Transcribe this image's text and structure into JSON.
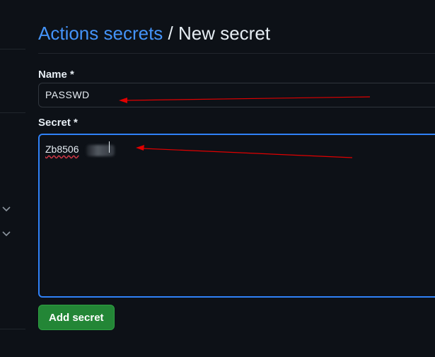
{
  "header": {
    "breadcrumb_link": "Actions secrets",
    "separator": " / ",
    "current": "New secret"
  },
  "form": {
    "name_label": "Name *",
    "name_value": "PASSWD",
    "secret_label": "Secret *",
    "secret_value_visible": "Zb8506"
  },
  "actions": {
    "add_label": "Add secret"
  },
  "colors": {
    "link": "#4493f8",
    "focus_border": "#2f81f7",
    "primary_button": "#238636",
    "annotation_arrow": "#e00000",
    "background": "#0d1117"
  },
  "icons": {
    "sidebar_expanders": [
      "chevron-down-icon",
      "chevron-down-icon"
    ]
  }
}
